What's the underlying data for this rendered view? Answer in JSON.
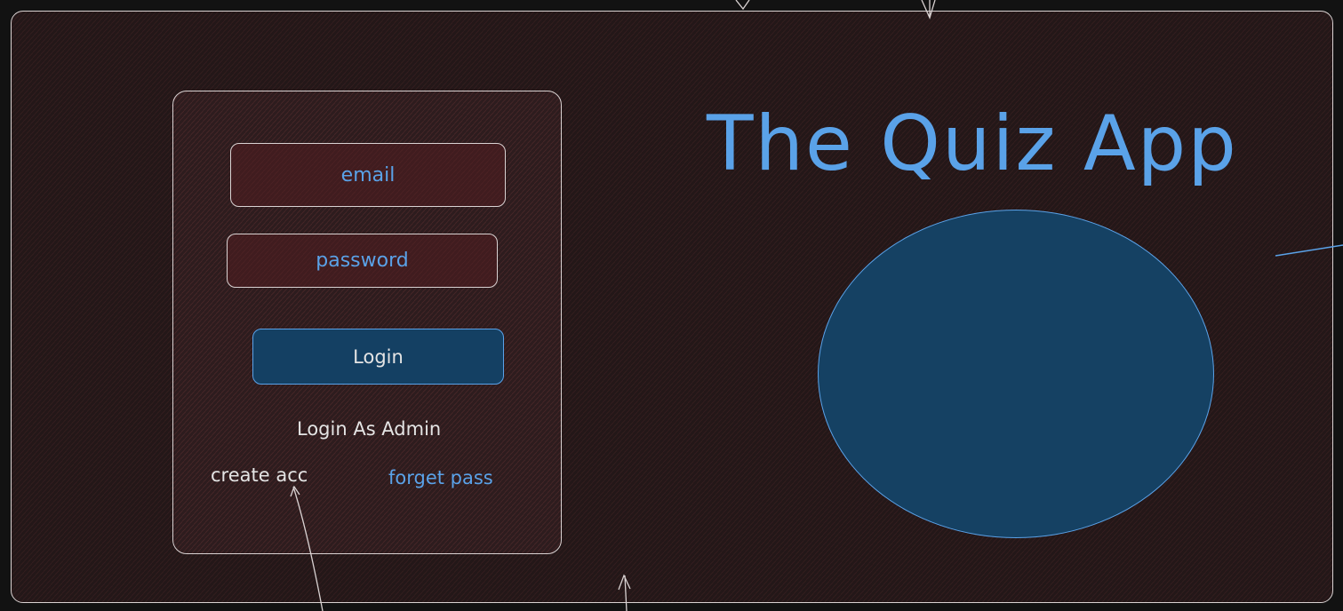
{
  "title": "The Quiz App",
  "login_form": {
    "email_placeholder": "email",
    "password_placeholder": "password",
    "login_button": "Login",
    "admin_link": "Login As Admin",
    "create_account_link": "create acc",
    "forgot_password_link": "forget pass"
  },
  "colors": {
    "accent": "#5aa2e8",
    "button_fill": "#144063",
    "circle_fill": "#154163",
    "card_fill": "#2d1c1e",
    "background": "#121212",
    "stroke": "#d9d2d2"
  }
}
